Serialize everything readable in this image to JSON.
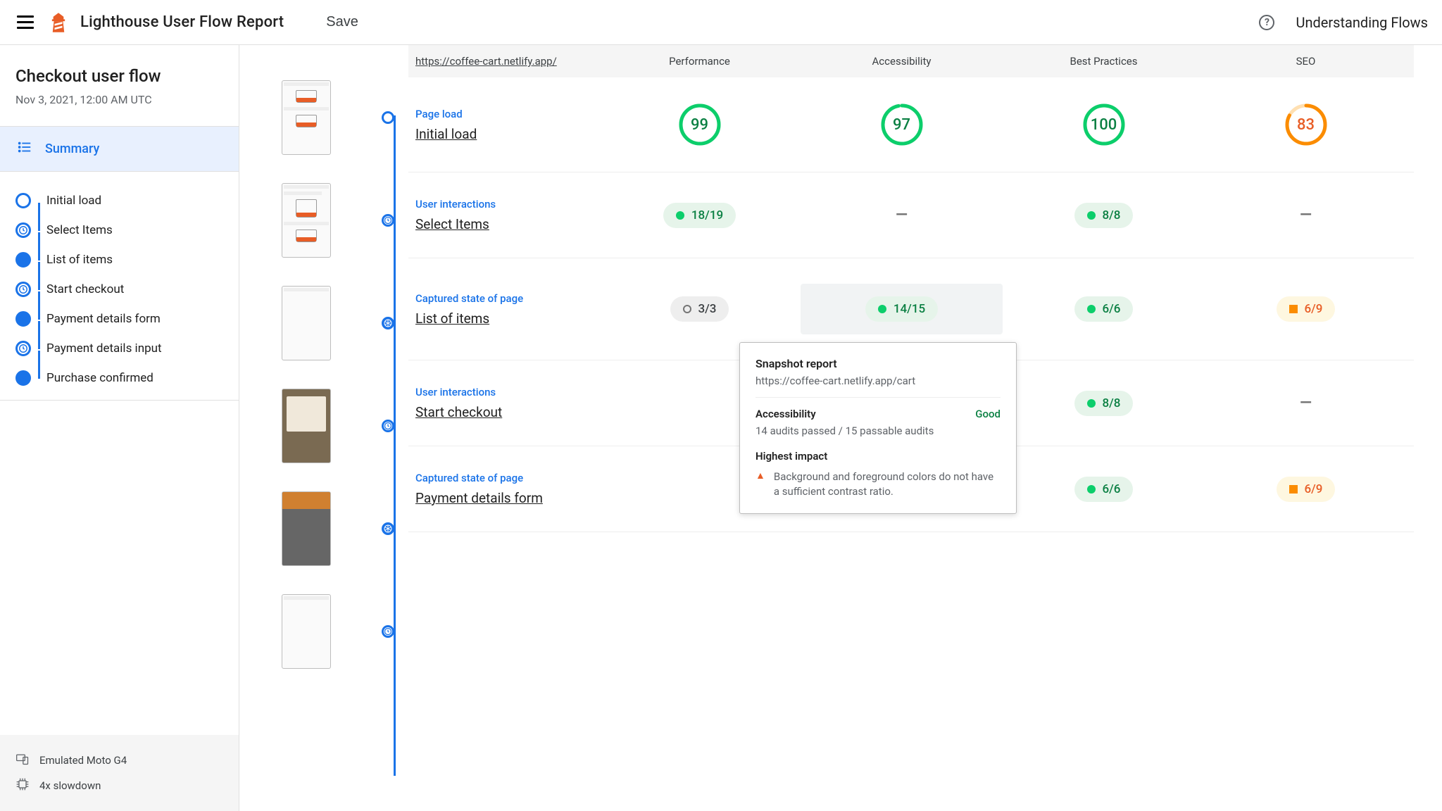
{
  "header": {
    "title": "Lighthouse User Flow Report",
    "save": "Save",
    "help": "Understanding Flows"
  },
  "sidebar": {
    "flowTitle": "Checkout user flow",
    "date": "Nov 3, 2021, 12:00 AM UTC",
    "summary": "Summary",
    "steps": [
      {
        "label": "Initial load",
        "icon": "circle"
      },
      {
        "label": "Select Items",
        "icon": "clock"
      },
      {
        "label": "List of items",
        "icon": "aperture"
      },
      {
        "label": "Start checkout",
        "icon": "clock"
      },
      {
        "label": "Payment details form",
        "icon": "aperture"
      },
      {
        "label": "Payment details input",
        "icon": "clock"
      },
      {
        "label": "Purchase confirmed",
        "icon": "aperture"
      }
    ],
    "device": "Emulated Moto G4",
    "throttle": "4x slowdown"
  },
  "columns": {
    "url": "https://coffee-cart.netlify.app/",
    "perf": "Performance",
    "a11y": "Accessibility",
    "bp": "Best Practices",
    "seo": "SEO"
  },
  "rows": [
    {
      "kind": "Page load",
      "name": "Initial load",
      "cells": [
        {
          "type": "gauge",
          "value": "99",
          "cls": "green",
          "pct": 99
        },
        {
          "type": "gauge",
          "value": "97",
          "cls": "green",
          "pct": 97
        },
        {
          "type": "gauge",
          "value": "100",
          "cls": "green",
          "pct": 100
        },
        {
          "type": "gauge",
          "value": "83",
          "cls": "orange",
          "pct": 83
        }
      ]
    },
    {
      "kind": "User interactions",
      "name": "Select Items",
      "cells": [
        {
          "type": "pill",
          "value": "18/19",
          "cls": "green"
        },
        {
          "type": "dash"
        },
        {
          "type": "pill",
          "value": "8/8",
          "cls": "green"
        },
        {
          "type": "dash"
        }
      ]
    },
    {
      "kind": "Captured state of page",
      "name": "List of items",
      "cells": [
        {
          "type": "pill",
          "value": "3/3",
          "cls": "gray"
        },
        {
          "type": "pill",
          "value": "14/15",
          "cls": "green",
          "hover": true
        },
        {
          "type": "pill",
          "value": "6/6",
          "cls": "green"
        },
        {
          "type": "pill",
          "value": "6/9",
          "cls": "orange"
        }
      ]
    },
    {
      "kind": "User interactions",
      "name": "Start checkout",
      "cells": [
        {
          "type": "hidden"
        },
        {
          "type": "hidden"
        },
        {
          "type": "pill",
          "value": "8/8",
          "cls": "green"
        },
        {
          "type": "dash"
        }
      ]
    },
    {
      "kind": "Captured state of page",
      "name": "Payment details form",
      "cells": [
        {
          "type": "hidden"
        },
        {
          "type": "hidden"
        },
        {
          "type": "pill",
          "value": "6/6",
          "cls": "green"
        },
        {
          "type": "pill",
          "value": "6/9",
          "cls": "orange"
        }
      ]
    }
  ],
  "tooltip": {
    "title": "Snapshot report",
    "url": "https://coffee-cart.netlify.app/cart",
    "category": "Accessibility",
    "status": "Good",
    "sub": "14 audits passed / 15 passable audits",
    "impactTitle": "Highest impact",
    "impactText": "Background and foreground colors do not have a sufficient contrast ratio."
  },
  "timeline": [
    {
      "icon": "circle",
      "thumb": "cups"
    },
    {
      "icon": "clock",
      "thumb": "cups2"
    },
    {
      "icon": "aperture",
      "thumb": "blank"
    },
    {
      "icon": "clock",
      "thumb": "brown"
    },
    {
      "icon": "aperture",
      "thumb": "dark"
    },
    {
      "icon": "clock",
      "thumb": "blank2"
    }
  ]
}
